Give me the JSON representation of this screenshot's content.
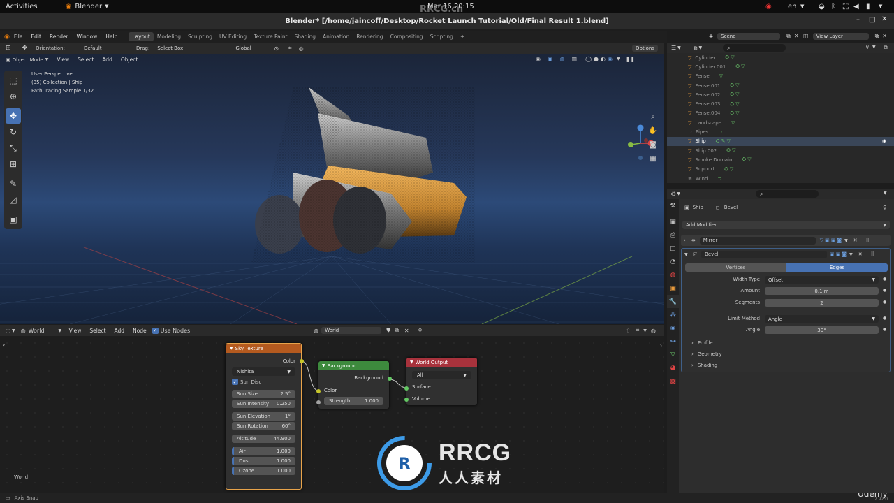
{
  "gnome": {
    "activities": "Activities",
    "app": "Blender",
    "datetime": "Mar 16 20:15",
    "lang": "en"
  },
  "window": {
    "title": "Blender* [/home/jaincoff/Desktop/Rocket Launch Tutorial/Old/Final Result 1.blend]"
  },
  "watermark_top": "RRCG.cn",
  "menu": [
    "File",
    "Edit",
    "Render",
    "Window",
    "Help"
  ],
  "workspaces": [
    "Layout",
    "Modeling",
    "Sculpting",
    "UV Editing",
    "Texture Paint",
    "Shading",
    "Animation",
    "Rendering",
    "Compositing",
    "Scripting"
  ],
  "top_right": {
    "scene_label": "Scene",
    "view_layer_label": "View Layer"
  },
  "viewport_header": {
    "orientation_label": "Orientation:",
    "orientation_value": "Default",
    "drag_label": "Drag:",
    "drag_value": "Select Box",
    "transform": "Global",
    "options": "Options"
  },
  "viewport_sub": {
    "mode": "Object Mode",
    "items": [
      "View",
      "Select",
      "Add",
      "Object"
    ]
  },
  "viewport_info": {
    "line1": "User Perspective",
    "line2": "(35) Collection | Ship",
    "line3": "Path Tracing Sample 1/32"
  },
  "node_header": {
    "type": "World",
    "items": [
      "View",
      "Select",
      "Add",
      "Node"
    ],
    "use_nodes": "Use Nodes",
    "world_name": "World"
  },
  "nodes": {
    "sky": {
      "title": "Sky Texture",
      "out_color": "Color",
      "sky_type": "Nishita",
      "sun_disc": "Sun Disc",
      "fields": [
        {
          "label": "Sun Size",
          "value": "2.5°"
        },
        {
          "label": "Sun Intensity",
          "value": "0.250"
        },
        {
          "label": "Sun Elevation",
          "value": "1°"
        },
        {
          "label": "Sun Rotation",
          "value": "60°"
        },
        {
          "label": "Altitude",
          "value": "44.900"
        },
        {
          "label": "Air",
          "value": "1.000"
        },
        {
          "label": "Dust",
          "value": "1.000"
        },
        {
          "label": "Ozone",
          "value": "1.000"
        }
      ]
    },
    "background": {
      "title": "Background",
      "out": "Background",
      "in_color": "Color",
      "strength_label": "Strength",
      "strength_value": "1.000"
    },
    "output": {
      "title": "World Output",
      "target": "All",
      "surface": "Surface",
      "volume": "Volume"
    }
  },
  "node_corner_label": "World",
  "status": {
    "left": "Axis Snap",
    "brand": "Udemy",
    "version": "2.92.0"
  },
  "outliner": {
    "rows": [
      {
        "name": "Cylinder",
        "selected": false
      },
      {
        "name": "Cylinder.001",
        "selected": false
      },
      {
        "name": "Fense",
        "selected": false
      },
      {
        "name": "Fense.001",
        "selected": false
      },
      {
        "name": "Fense.002",
        "selected": false
      },
      {
        "name": "Fense.003",
        "selected": false
      },
      {
        "name": "Fense.004",
        "selected": false
      },
      {
        "name": "Landscape",
        "selected": false
      },
      {
        "name": "Pipes",
        "selected": false
      },
      {
        "name": "Ship",
        "selected": true
      },
      {
        "name": "Ship.002",
        "selected": false
      },
      {
        "name": "Smoke Domain",
        "selected": false
      },
      {
        "name": "Support",
        "selected": false
      },
      {
        "name": "Wind",
        "selected": false
      }
    ]
  },
  "properties": {
    "object": "Ship",
    "modifier_context": "Bevel",
    "add_modifier": "Add Modifier",
    "mirror_name": "Mirror",
    "bevel_name": "Bevel",
    "affect_tabs": [
      "Vertices",
      "Edges"
    ],
    "width_type_label": "Width Type",
    "width_type_value": "Offset",
    "amount_label": "Amount",
    "amount_value": "0.1 m",
    "segments_label": "Segments",
    "segments_value": "2",
    "limit_label": "Limit Method",
    "limit_value": "Angle",
    "angle_label": "Angle",
    "angle_value": "30°",
    "panels": [
      "Profile",
      "Geometry",
      "Shading"
    ]
  },
  "watermark": {
    "brand": "RRCG",
    "cn": "人人素材"
  }
}
